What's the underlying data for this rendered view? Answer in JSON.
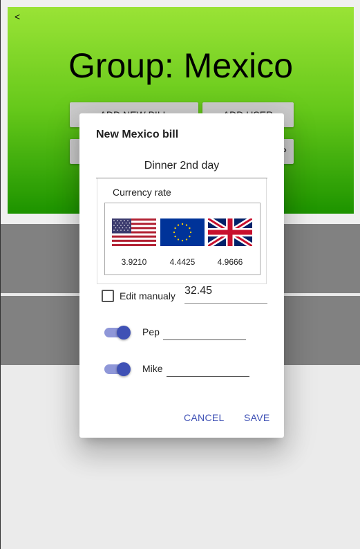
{
  "page": {
    "back_label": "<",
    "title": "Group: Mexico",
    "buttons": [
      "ADD NEW BILL",
      "ADD USER",
      "",
      "P"
    ]
  },
  "dialog": {
    "title": "New Mexico bill",
    "description_value": "Dinner 2nd day",
    "currency_rate_label": "Currency rate",
    "currencies": [
      {
        "flag": "us-flag-icon",
        "rate": "3.9210"
      },
      {
        "flag": "eu-flag-icon",
        "rate": "4.4425"
      },
      {
        "flag": "uk-flag-icon",
        "rate": "4.9666"
      }
    ],
    "manual_label": "Edit manualy",
    "manual_value": "32.45",
    "manual_checked": false,
    "people": [
      {
        "name": "Pep",
        "enabled": true,
        "amount": ""
      },
      {
        "name": "Mike",
        "enabled": true,
        "amount": ""
      }
    ],
    "cancel_label": "CANCEL",
    "save_label": "SAVE"
  },
  "colors": {
    "accent": "#3f51b5",
    "header_top": "#a4f23a",
    "header_bottom": "#1f9d00",
    "row_gray": "#8a8a8a"
  }
}
